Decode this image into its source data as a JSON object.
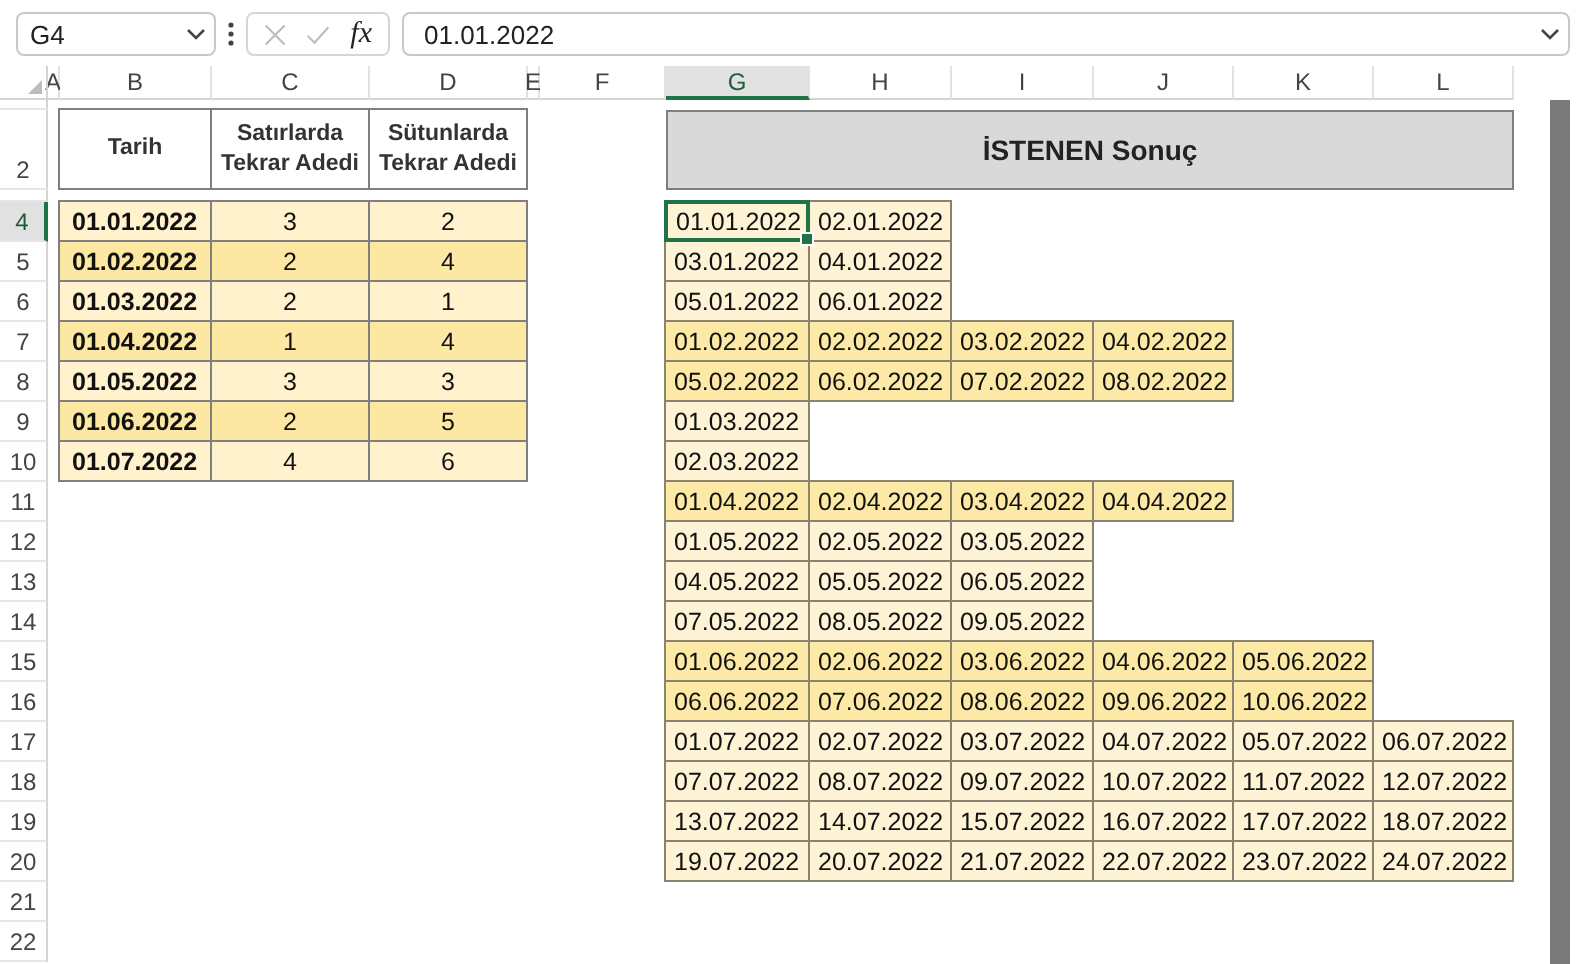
{
  "formula_bar": {
    "name_box": "G4",
    "fx": "fx",
    "value": "01.01.2022"
  },
  "columns": [
    {
      "label": "A",
      "selected": false
    },
    {
      "label": "B",
      "selected": false
    },
    {
      "label": "C",
      "selected": false
    },
    {
      "label": "D",
      "selected": false
    },
    {
      "label": "E",
      "selected": false
    },
    {
      "label": "F",
      "selected": false
    },
    {
      "label": "G",
      "selected": true
    },
    {
      "label": "H",
      "selected": false
    },
    {
      "label": "I",
      "selected": false
    },
    {
      "label": "J",
      "selected": false
    },
    {
      "label": "K",
      "selected": false
    },
    {
      "label": "L",
      "selected": false
    }
  ],
  "row_headers": [
    {
      "label": "2",
      "selected": false
    },
    {
      "label": "4",
      "selected": true
    },
    {
      "label": "5",
      "selected": false
    },
    {
      "label": "6",
      "selected": false
    },
    {
      "label": "7",
      "selected": false
    },
    {
      "label": "8",
      "selected": false
    },
    {
      "label": "9",
      "selected": false
    },
    {
      "label": "10",
      "selected": false
    },
    {
      "label": "11",
      "selected": false
    },
    {
      "label": "12",
      "selected": false
    },
    {
      "label": "13",
      "selected": false
    },
    {
      "label": "14",
      "selected": false
    },
    {
      "label": "15",
      "selected": false
    },
    {
      "label": "16",
      "selected": false
    },
    {
      "label": "17",
      "selected": false
    },
    {
      "label": "18",
      "selected": false
    },
    {
      "label": "19",
      "selected": false
    },
    {
      "label": "20",
      "selected": false
    },
    {
      "label": "21",
      "selected": false
    },
    {
      "label": "22",
      "selected": false
    }
  ],
  "source_table": {
    "headers": [
      "Tarih",
      "Satırlarda Tekrar Adedi",
      "Sütunlarda Tekrar Adedi"
    ],
    "rows": [
      {
        "date": "01.01.2022",
        "row_repeat": "3",
        "column_repeat": "2",
        "highlighted": false
      },
      {
        "date": "01.02.2022",
        "row_repeat": "2",
        "column_repeat": "4",
        "highlighted": true
      },
      {
        "date": "01.03.2022",
        "row_repeat": "2",
        "column_repeat": "1",
        "highlighted": false
      },
      {
        "date": "01.04.2022",
        "row_repeat": "1",
        "column_repeat": "4",
        "highlighted": true
      },
      {
        "date": "01.05.2022",
        "row_repeat": "3",
        "column_repeat": "3",
        "highlighted": false
      },
      {
        "date": "01.06.2022",
        "row_repeat": "2",
        "column_repeat": "5",
        "highlighted": true
      },
      {
        "date": "01.07.2022",
        "row_repeat": "4",
        "column_repeat": "6",
        "highlighted": false
      }
    ]
  },
  "result": {
    "title": "İSTENEN Sonuç",
    "rows": [
      {
        "highlighted": false,
        "cells": [
          {
            "text": "01.01.2022",
            "selected": true
          },
          {
            "text": "02.01.2022",
            "selected": false
          }
        ]
      },
      {
        "highlighted": false,
        "cells": [
          {
            "text": "03.01.2022",
            "selected": false
          },
          {
            "text": "04.01.2022",
            "selected": false
          }
        ]
      },
      {
        "highlighted": false,
        "cells": [
          {
            "text": "05.01.2022",
            "selected": false
          },
          {
            "text": "06.01.2022",
            "selected": false
          }
        ]
      },
      {
        "highlighted": true,
        "cells": [
          {
            "text": "01.02.2022",
            "selected": false
          },
          {
            "text": "02.02.2022",
            "selected": false
          },
          {
            "text": "03.02.2022",
            "selected": false
          },
          {
            "text": "04.02.2022",
            "selected": false
          }
        ]
      },
      {
        "highlighted": true,
        "cells": [
          {
            "text": "05.02.2022",
            "selected": false
          },
          {
            "text": "06.02.2022",
            "selected": false
          },
          {
            "text": "07.02.2022",
            "selected": false
          },
          {
            "text": "08.02.2022",
            "selected": false
          }
        ]
      },
      {
        "highlighted": false,
        "cells": [
          {
            "text": "01.03.2022",
            "selected": false
          }
        ]
      },
      {
        "highlighted": false,
        "cells": [
          {
            "text": "02.03.2022",
            "selected": false
          }
        ]
      },
      {
        "highlighted": true,
        "cells": [
          {
            "text": "01.04.2022",
            "selected": false
          },
          {
            "text": "02.04.2022",
            "selected": false
          },
          {
            "text": "03.04.2022",
            "selected": false
          },
          {
            "text": "04.04.2022",
            "selected": false
          }
        ]
      },
      {
        "highlighted": false,
        "cells": [
          {
            "text": "01.05.2022",
            "selected": false
          },
          {
            "text": "02.05.2022",
            "selected": false
          },
          {
            "text": "03.05.2022",
            "selected": false
          }
        ]
      },
      {
        "highlighted": false,
        "cells": [
          {
            "text": "04.05.2022",
            "selected": false
          },
          {
            "text": "05.05.2022",
            "selected": false
          },
          {
            "text": "06.05.2022",
            "selected": false
          }
        ]
      },
      {
        "highlighted": false,
        "cells": [
          {
            "text": "07.05.2022",
            "selected": false
          },
          {
            "text": "08.05.2022",
            "selected": false
          },
          {
            "text": "09.05.2022",
            "selected": false
          }
        ]
      },
      {
        "highlighted": true,
        "cells": [
          {
            "text": "01.06.2022",
            "selected": false
          },
          {
            "text": "02.06.2022",
            "selected": false
          },
          {
            "text": "03.06.2022",
            "selected": false
          },
          {
            "text": "04.06.2022",
            "selected": false
          },
          {
            "text": "05.06.2022",
            "selected": false
          }
        ]
      },
      {
        "highlighted": true,
        "cells": [
          {
            "text": "06.06.2022",
            "selected": false
          },
          {
            "text": "07.06.2022",
            "selected": false
          },
          {
            "text": "08.06.2022",
            "selected": false
          },
          {
            "text": "09.06.2022",
            "selected": false
          },
          {
            "text": "10.06.2022",
            "selected": false
          }
        ]
      },
      {
        "highlighted": false,
        "cells": [
          {
            "text": "01.07.2022",
            "selected": false
          },
          {
            "text": "02.07.2022",
            "selected": false
          },
          {
            "text": "03.07.2022",
            "selected": false
          },
          {
            "text": "04.07.2022",
            "selected": false
          },
          {
            "text": "05.07.2022",
            "selected": false
          },
          {
            "text": "06.07.2022",
            "selected": false
          }
        ]
      },
      {
        "highlighted": false,
        "cells": [
          {
            "text": "07.07.2022",
            "selected": false
          },
          {
            "text": "08.07.2022",
            "selected": false
          },
          {
            "text": "09.07.2022",
            "selected": false
          },
          {
            "text": "10.07.2022",
            "selected": false
          },
          {
            "text": "11.07.2022",
            "selected": false
          },
          {
            "text": "12.07.2022",
            "selected": false
          }
        ]
      },
      {
        "highlighted": false,
        "cells": [
          {
            "text": "13.07.2022",
            "selected": false
          },
          {
            "text": "14.07.2022",
            "selected": false
          },
          {
            "text": "15.07.2022",
            "selected": false
          },
          {
            "text": "16.07.2022",
            "selected": false
          },
          {
            "text": "17.07.2022",
            "selected": false
          },
          {
            "text": "18.07.2022",
            "selected": false
          }
        ]
      },
      {
        "highlighted": false,
        "cells": [
          {
            "text": "19.07.2022",
            "selected": false
          },
          {
            "text": "20.07.2022",
            "selected": false
          },
          {
            "text": "21.07.2022",
            "selected": false
          },
          {
            "text": "22.07.2022",
            "selected": false
          },
          {
            "text": "23.07.2022",
            "selected": false
          },
          {
            "text": "24.07.2022",
            "selected": false
          }
        ]
      }
    ]
  }
}
